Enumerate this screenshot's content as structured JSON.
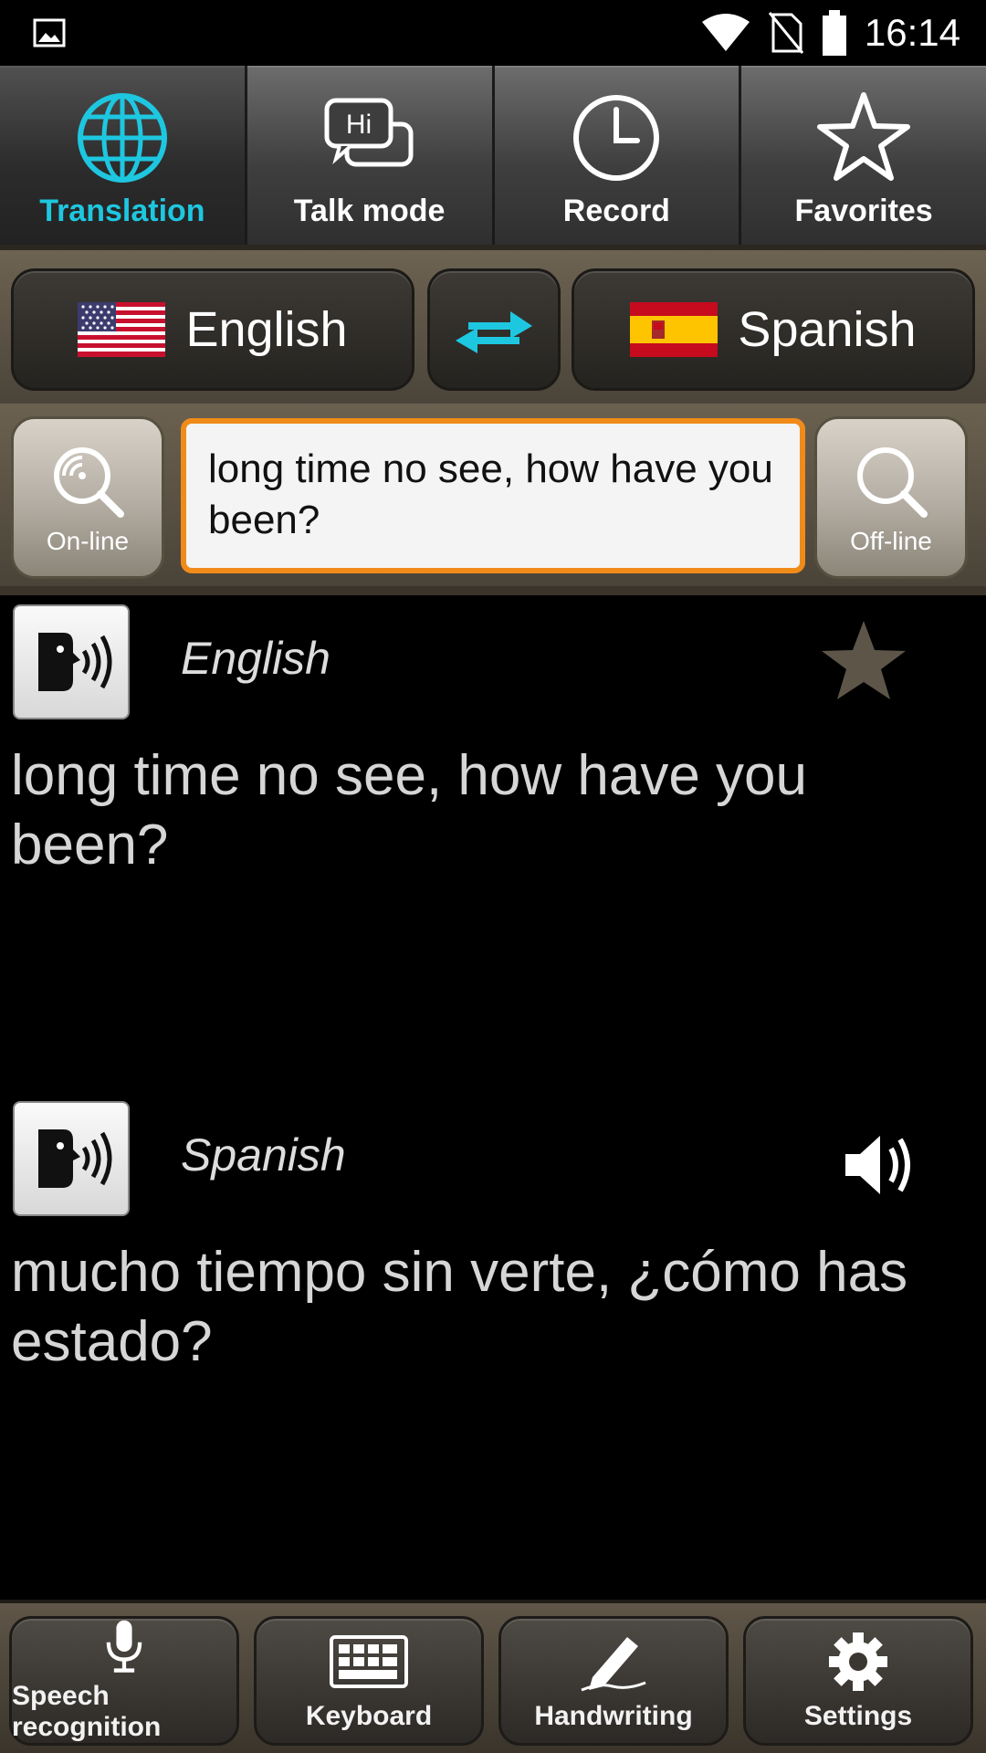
{
  "status_bar": {
    "time": "16:14",
    "icons": [
      "image-icon",
      "wifi-icon",
      "no-sim-icon",
      "battery-icon"
    ]
  },
  "tabs": [
    {
      "label": "Translation",
      "icon": "globe-icon",
      "active": true
    },
    {
      "label": "Talk mode",
      "icon": "chat-bubbles-icon",
      "active": false
    },
    {
      "label": "Record",
      "icon": "clock-icon",
      "active": false
    },
    {
      "label": "Favorites",
      "icon": "star-icon",
      "active": false
    }
  ],
  "languages": {
    "source": {
      "name": "English",
      "flag": "us-flag-icon"
    },
    "swap_icon": "swap-arrows-icon",
    "target": {
      "name": "Spanish",
      "flag": "spain-flag-icon"
    }
  },
  "search": {
    "online_label": "On-line",
    "offline_label": "Off-line",
    "input_value": "long time no see, how have you been?"
  },
  "results": {
    "source": {
      "language": "English",
      "text": "long time no see, how have you been?"
    },
    "target": {
      "language": "Spanish",
      "text": "mucho tiempo sin verte, ¿cómo has estado?"
    }
  },
  "toolbar": [
    {
      "label": "Speech recognition",
      "icon": "microphone-icon"
    },
    {
      "label": "Keyboard",
      "icon": "keyboard-icon"
    },
    {
      "label": "Handwriting",
      "icon": "pen-icon"
    },
    {
      "label": "Settings",
      "icon": "gear-icon"
    }
  ],
  "colors": {
    "accent": "#1ec7e0",
    "input_border": "#f08b1a",
    "panel": "#5b5244"
  }
}
